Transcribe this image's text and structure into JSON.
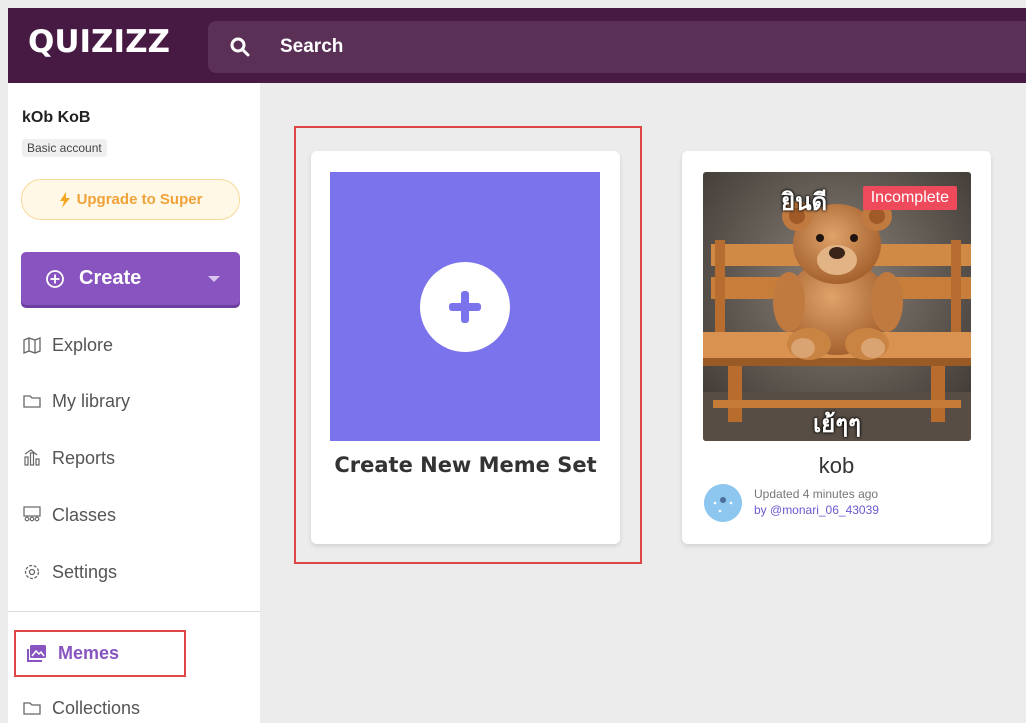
{
  "header": {
    "logo": "QUIZIZZ",
    "search_label": "Search"
  },
  "user": {
    "name": "kOb KoB",
    "account_type": "Basic account"
  },
  "sidebar": {
    "upgrade_label": "Upgrade to Super",
    "create_label": "Create",
    "items": [
      {
        "label": "Explore",
        "icon": "explore-icon"
      },
      {
        "label": "My library",
        "icon": "folder-icon"
      },
      {
        "label": "Reports",
        "icon": "reports-icon"
      },
      {
        "label": "Classes",
        "icon": "classes-icon"
      },
      {
        "label": "Settings",
        "icon": "gear-icon"
      },
      {
        "label": "Memes",
        "icon": "memes-icon",
        "active": true
      },
      {
        "label": "Collections",
        "icon": "folder-icon"
      }
    ]
  },
  "main": {
    "new_card_label": "Create New Meme Set",
    "meme_set": {
      "badge": "Incomplete",
      "caption_top": "ยินดี",
      "caption_bottom": "เย้ๆๆ",
      "name": "kob",
      "updated": "Updated 4 minutes ago",
      "author": "by @monari_06_43039"
    }
  },
  "colors": {
    "header_bg": "#461a42",
    "accent_purple": "#8854c0",
    "tile_purple": "#7b73eb",
    "badge_red": "#ef4a5b",
    "highlight_red": "#e04646"
  }
}
